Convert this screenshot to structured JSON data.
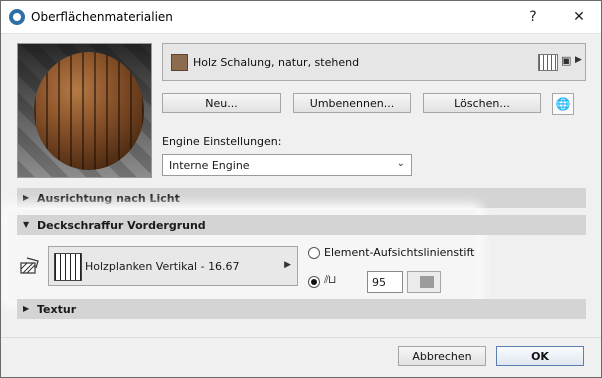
{
  "window": {
    "title": "Oberflächenmaterialien",
    "help_label": "?",
    "close_label": "✕"
  },
  "material": {
    "name": "Holz Schalung, natur, stehend",
    "swatch_color": "#8d6b4f"
  },
  "buttons": {
    "new": "Neu...",
    "rename": "Umbenennen...",
    "delete": "Löschen...",
    "cancel": "Abbrechen",
    "ok": "OK"
  },
  "engine": {
    "label": "Engine Einstellungen:",
    "value": "Interne Engine"
  },
  "sections": {
    "light": "Ausrichtung nach Licht",
    "foreground_fill": "Deckschraffur Vordergrund",
    "texture": "Textur"
  },
  "fill": {
    "name": "Holzplanken Vertikal - 16.67",
    "option_element": "Element-Aufsichtslinienstift",
    "selected_option": "custom-pen",
    "pen_number": "95"
  },
  "icons": {
    "app": "archicad-icon",
    "globe": "globe-icon",
    "fill": "fill-type-icon",
    "image": "image-icon",
    "pen": "pen-icon"
  }
}
